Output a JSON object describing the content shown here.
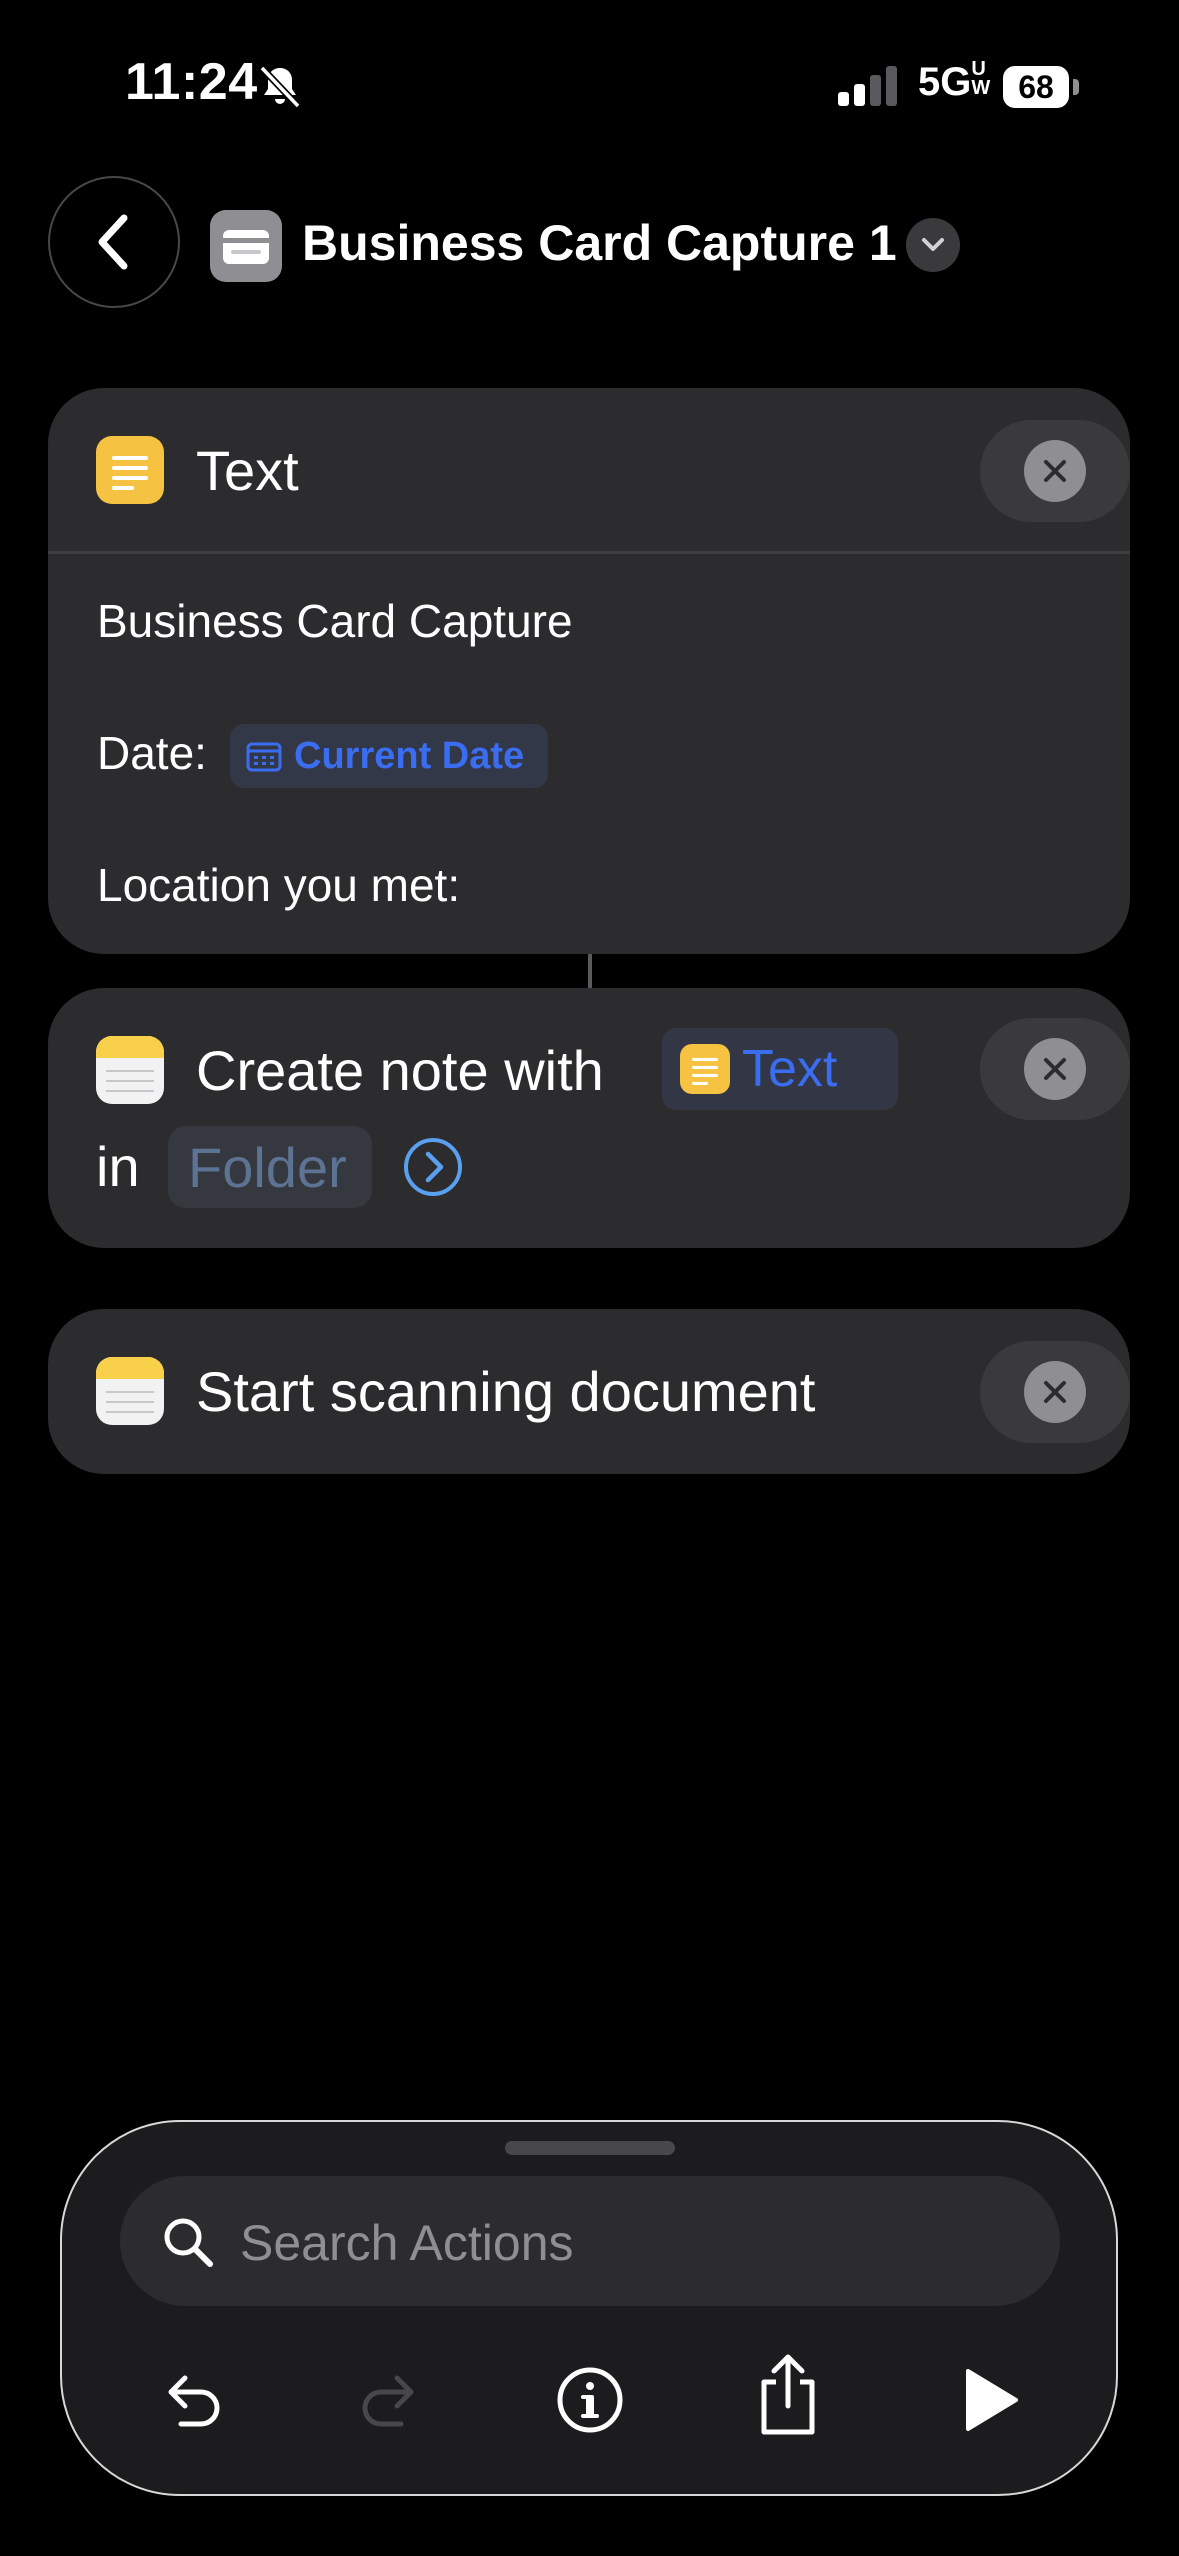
{
  "status_bar": {
    "time": "11:24",
    "network": "5G",
    "network_suffix": "UW",
    "battery": "68"
  },
  "header": {
    "title": "Business Card Capture 1"
  },
  "actions": [
    {
      "title": "Text",
      "lines": {
        "line1": "Business Card Capture",
        "date_label": "Date:",
        "date_variable": "Current Date",
        "location_label": "Location you met:"
      }
    },
    {
      "title": "Create note with",
      "text_variable": "Text",
      "in_label": "in",
      "folder_placeholder": "Folder"
    },
    {
      "title": "Start scanning document"
    }
  ],
  "search": {
    "placeholder": "Search Actions"
  },
  "colors": {
    "accent_blue": "#3a6df0",
    "card_bg": "#2c2c2e",
    "text_yellow": "#f5c242"
  }
}
